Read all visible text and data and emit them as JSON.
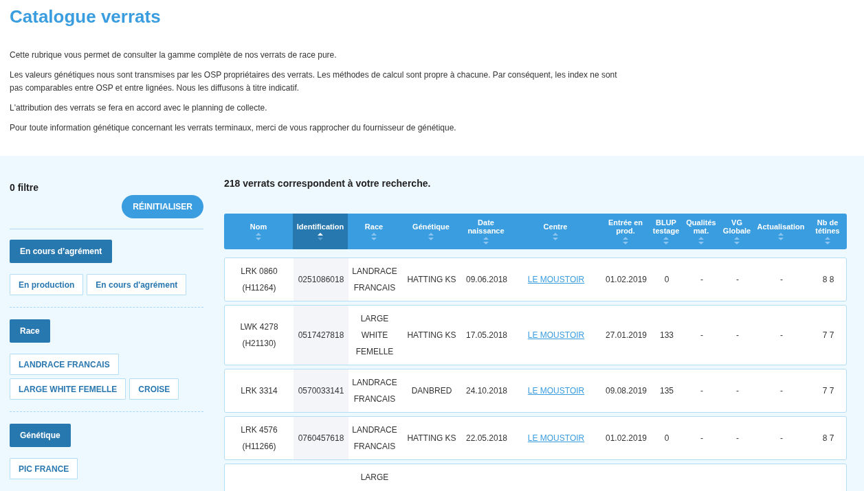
{
  "page": {
    "title": "Catalogue verrats",
    "paragraphs": [
      "Cette rubrique vous permet de consulter la gamme complète de nos verrats de race pure.",
      "Les valeurs génétiques nous sont transmises par les OSP propriétaires des verrats. Les méthodes de calcul sont propre à chacune. Par conséquent, les index ne sont pas comparables entre OSP et entre lignées. Nous les diffusons à titre indicatif.",
      "L'attribution des verrats se fera en accord avec le planning de collecte.",
      "Pour toute information génétique concernant les verrats terminaux, merci de vous rapprocher du fournisseur de génétique."
    ]
  },
  "filters": {
    "count_label": "0 filtre",
    "reset_button": "RÉINITIALISER",
    "groups": [
      {
        "heading": "En cours d’agrément",
        "options": [
          {
            "label": "En production",
            "selected": false
          },
          {
            "label": "En cours d'agrément",
            "selected": false
          }
        ]
      },
      {
        "heading": "Race",
        "options": [
          {
            "label": "LANDRACE FRANCAIS",
            "selected": false
          },
          {
            "label": "LARGE WHITE FEMELLE",
            "selected": false
          },
          {
            "label": "CROISE",
            "selected": false
          }
        ]
      },
      {
        "heading": "Génétique",
        "options": [
          {
            "label": "PIC FRANCE",
            "selected": false
          }
        ]
      }
    ]
  },
  "results": {
    "summary": "218 verrats correspondent à votre recherche.",
    "columns": [
      {
        "label": "Nom",
        "kind": "wrap",
        "selected": false
      },
      {
        "label": "Identification",
        "kind": "id",
        "selected": true
      },
      {
        "label": "Race",
        "kind": "wrap",
        "selected": false
      },
      {
        "label": "Génétique",
        "kind": "text",
        "selected": false
      },
      {
        "label": "Date naissance",
        "kind": "text",
        "selected": false
      },
      {
        "label": "Centre",
        "kind": "link",
        "selected": false
      },
      {
        "label": "Entrée en prod.",
        "kind": "text",
        "selected": false
      },
      {
        "label": "BLUP testage",
        "kind": "text",
        "selected": false
      },
      {
        "label": "Qualités mat.",
        "kind": "text",
        "selected": false
      },
      {
        "label": "VG Globale",
        "kind": "text",
        "selected": false
      },
      {
        "label": "Actualisation",
        "kind": "text",
        "selected": false
      },
      {
        "label": "Nb de tétines",
        "kind": "text",
        "selected": false
      }
    ],
    "rows": [
      {
        "cells": [
          "LRK 0860 (H11264)",
          "0251086018",
          "LANDRACE FRANCAIS",
          "HATTING KS",
          "09.06.2018",
          "LE MOUSTOIR",
          "01.02.2019",
          "0",
          "-",
          "-",
          "-",
          "8 8"
        ]
      },
      {
        "cells": [
          "LWK 4278 (H21130)",
          "0517427818",
          "LARGE WHITE FEMELLE",
          "HATTING KS",
          "17.05.2018",
          "LE MOUSTOIR",
          "27.01.2019",
          "133",
          "-",
          "-",
          "-",
          "7 7"
        ]
      },
      {
        "cells": [
          "LRK 3314",
          "0570033141",
          "LANDRACE FRANCAIS",
          "DANBRED",
          "24.10.2018",
          "LE MOUSTOIR",
          "09.08.2019",
          "135",
          "-",
          "-",
          "-",
          "7 7"
        ]
      },
      {
        "cells": [
          "LRK 4576 (H11266)",
          "0760457618",
          "LANDRACE FRANCAIS",
          "HATTING KS",
          "22.05.2018",
          "LE MOUSTOIR",
          "01.02.2019",
          "0",
          "-",
          "-",
          "-",
          "8 7"
        ]
      },
      {
        "cells": [
          null,
          null,
          "LARGE",
          null,
          null,
          null,
          null,
          null,
          null,
          null,
          null,
          null
        ]
      }
    ]
  }
}
